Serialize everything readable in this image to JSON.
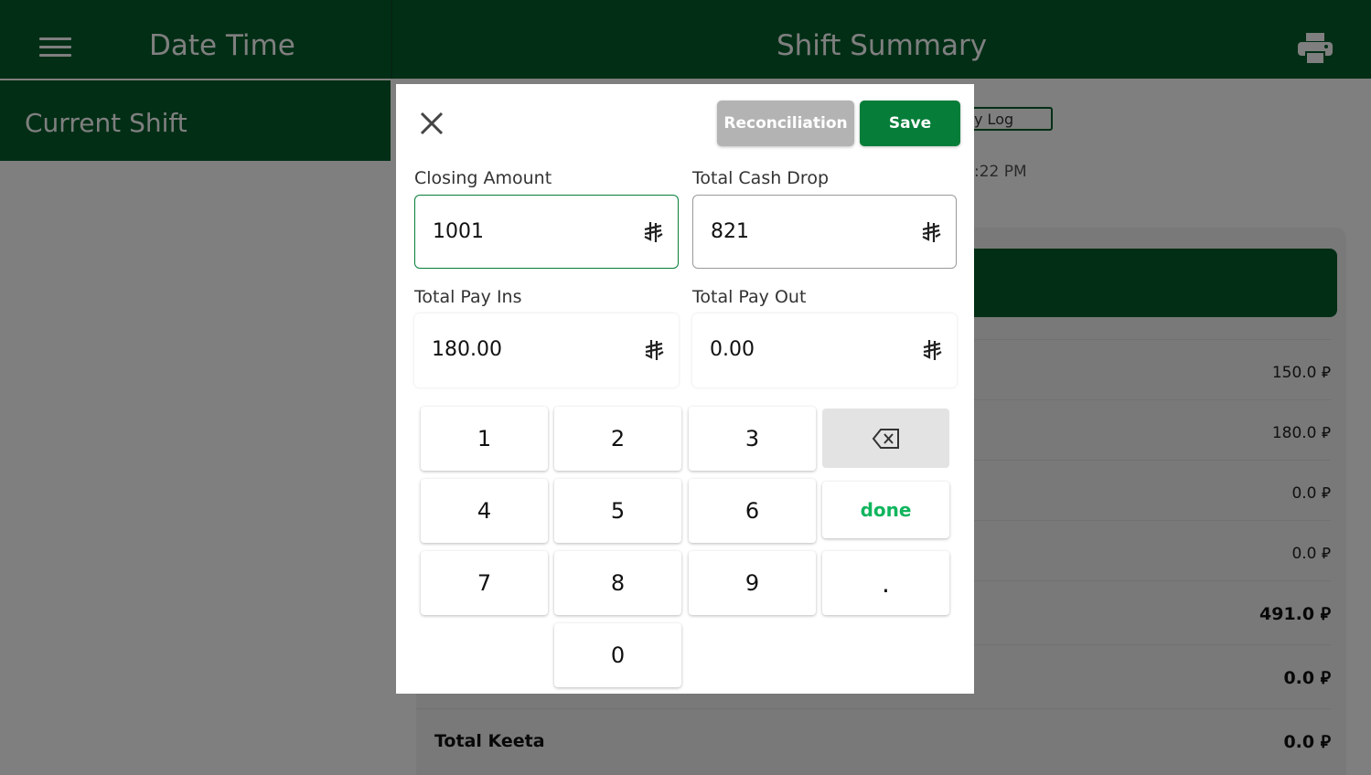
{
  "header": {
    "left_title": "Date Time",
    "main_title": "Shift Summary"
  },
  "sidebar": {
    "items": [
      {
        "label": "Current Shift"
      }
    ]
  },
  "background": {
    "log_button_label": "y Log",
    "time_text": ":22 PM",
    "rows": [
      {
        "label": "",
        "value": "150.0 ⃁"
      },
      {
        "label": "",
        "value": "180.0 ⃁"
      },
      {
        "label": "",
        "value": "0.0 ⃁"
      },
      {
        "label": "",
        "value": "0.0 ⃁"
      },
      {
        "label": "",
        "value": "491.0 ⃁"
      },
      {
        "label": "",
        "value": "0.0 ⃁"
      },
      {
        "label": "Total Keeta",
        "value": "0.0 ⃁"
      }
    ]
  },
  "modal": {
    "reconciliation_label": "Reconciliation",
    "save_label": "Save",
    "fields": {
      "closing_amount": {
        "label": "Closing Amount",
        "value": "1001"
      },
      "total_cash_drop": {
        "label": "Total Cash Drop",
        "value": "821"
      },
      "total_pay_ins": {
        "label": "Total Pay Ins",
        "value": "180.00"
      },
      "total_pay_out": {
        "label": "Total Pay Out",
        "value": "0.00"
      }
    },
    "keypad": {
      "k1": "1",
      "k2": "2",
      "k3": "3",
      "k4": "4",
      "k5": "5",
      "k6": "6",
      "k7": "7",
      "k8": "8",
      "k9": "9",
      "k0": "0",
      "dot": ".",
      "done": "done"
    }
  },
  "colors": {
    "brand_green": "#025c2a",
    "save_green": "#067d39",
    "done_green": "#10b55e",
    "disabled_gray": "#b3b3b3"
  },
  "icons": [
    "menu-icon",
    "printer-icon",
    "close-icon",
    "riyal-currency-icon",
    "backspace-icon"
  ]
}
